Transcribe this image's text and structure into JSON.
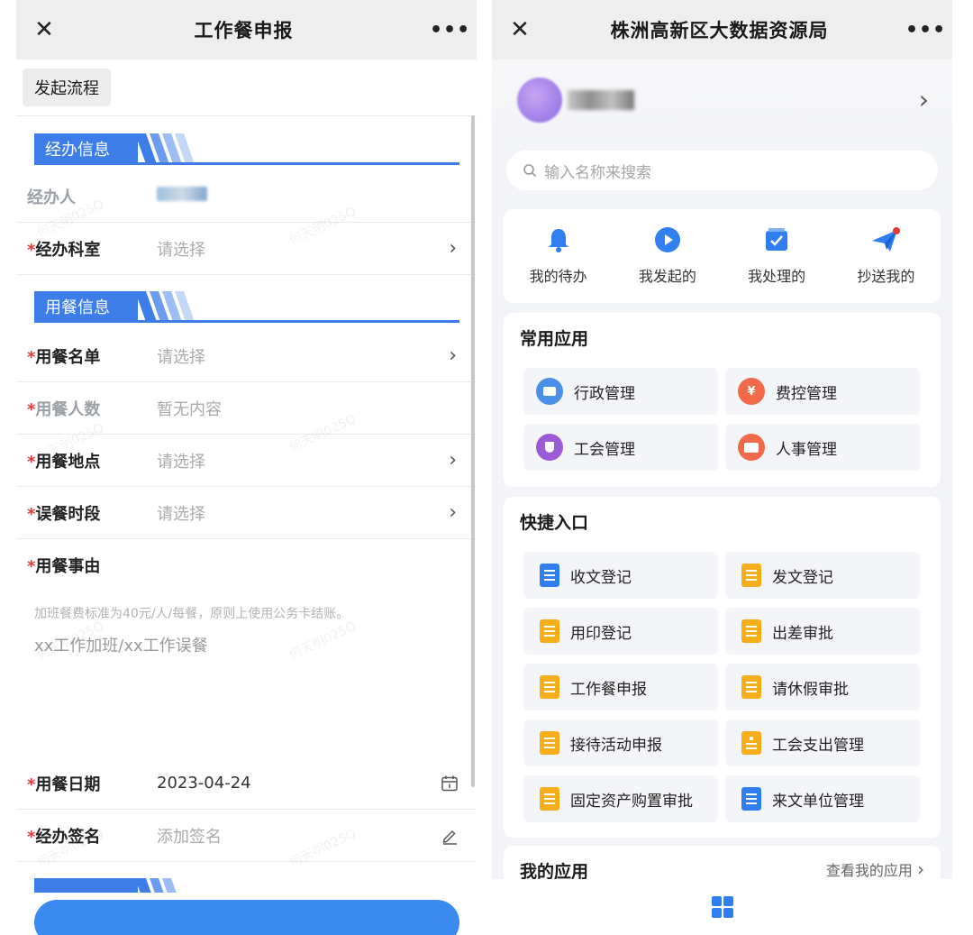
{
  "left": {
    "title": "工作餐申报",
    "start_button": "发起流程",
    "section1": "经办信息",
    "handler_label": "经办人",
    "dept_label": "经办科室",
    "dept_value": "请选择",
    "section2": "用餐信息",
    "meal_list_label": "用餐名单",
    "meal_list_value": "请选择",
    "meal_count_label": "用餐人数",
    "meal_count_value": "暂无内容",
    "meal_place_label": "用餐地点",
    "meal_place_value": "请选择",
    "missed_time_label": "误餐时段",
    "missed_time_value": "请选择",
    "reason_label": "用餐事由",
    "reason_hint": "加班餐费标准为40元/人/每餐，原则上使用公务卡结账。",
    "reason_placeholder": "xx工作加班/xx工作误餐",
    "date_label": "用餐日期",
    "date_value": "2023-04-24",
    "sign_label": "经办签名",
    "sign_value": "添加签名",
    "required_mark": "*",
    "watermark": "何天明025Q"
  },
  "right": {
    "title": "株洲高新区大数据资源局",
    "search_placeholder": "输入名称来搜索",
    "quick": [
      "我的待办",
      "我发起的",
      "我处理的",
      "抄送我的"
    ],
    "common_title": "常用应用",
    "common_apps": [
      "行政管理",
      "费控管理",
      "工会管理",
      "人事管理"
    ],
    "shortcut_title": "快捷入口",
    "shortcuts": [
      "收文登记",
      "发文登记",
      "用印登记",
      "出差审批",
      "工作餐申报",
      "请休假审批",
      "接待活动申报",
      "工会支出管理",
      "固定资产购置审批",
      "来文单位管理"
    ],
    "my_apps_title": "我的应用",
    "my_apps_link": "查看我的应用"
  },
  "colors": {
    "accent": "#3d7de8",
    "required": "#e03b3b",
    "doc_blue": "#2f7ff0",
    "doc_orange": "#f7ae1a"
  }
}
